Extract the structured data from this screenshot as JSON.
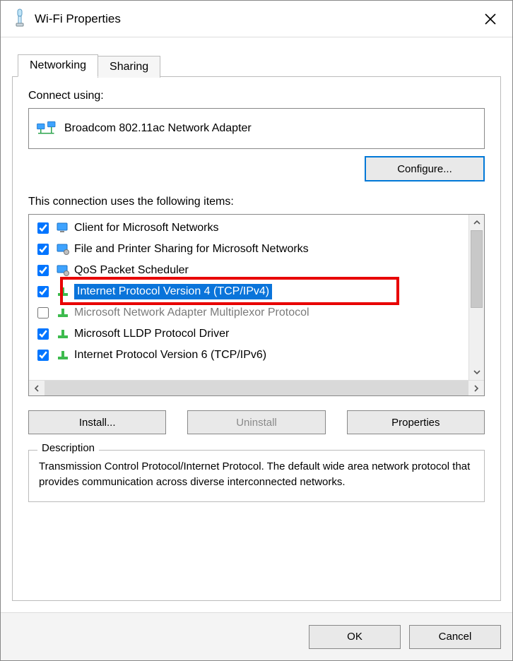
{
  "window": {
    "title": "Wi-Fi Properties"
  },
  "tabs": {
    "networking": "Networking",
    "sharing": "Sharing"
  },
  "connect_label": "Connect using:",
  "adapter": "Broadcom 802.11ac Network Adapter",
  "configure_btn": "Configure...",
  "items_label": "This connection uses the following items:",
  "items": [
    {
      "label": "Client for Microsoft Networks",
      "checked": true,
      "icon": "monitor",
      "selected": false,
      "disabled": false
    },
    {
      "label": "File and Printer Sharing for Microsoft Networks",
      "checked": true,
      "icon": "monitor-gear",
      "selected": false,
      "disabled": false
    },
    {
      "label": "QoS Packet Scheduler",
      "checked": true,
      "icon": "monitor-gear",
      "selected": false,
      "disabled": false
    },
    {
      "label": "Internet Protocol Version 4 (TCP/IPv4)",
      "checked": true,
      "icon": "net-green",
      "selected": true,
      "disabled": false
    },
    {
      "label": "Microsoft Network Adapter Multiplexor Protocol",
      "checked": false,
      "icon": "net-green",
      "selected": false,
      "disabled": true
    },
    {
      "label": "Microsoft LLDP Protocol Driver",
      "checked": true,
      "icon": "net-green",
      "selected": false,
      "disabled": false
    },
    {
      "label": "Internet Protocol Version 6 (TCP/IPv6)",
      "checked": true,
      "icon": "net-green",
      "selected": false,
      "disabled": false
    }
  ],
  "buttons": {
    "install": "Install...",
    "uninstall": "Uninstall",
    "properties": "Properties"
  },
  "description_legend": "Description",
  "description_text": "Transmission Control Protocol/Internet Protocol. The default wide area network protocol that provides communication across diverse interconnected networks.",
  "footer": {
    "ok": "OK",
    "cancel": "Cancel"
  }
}
